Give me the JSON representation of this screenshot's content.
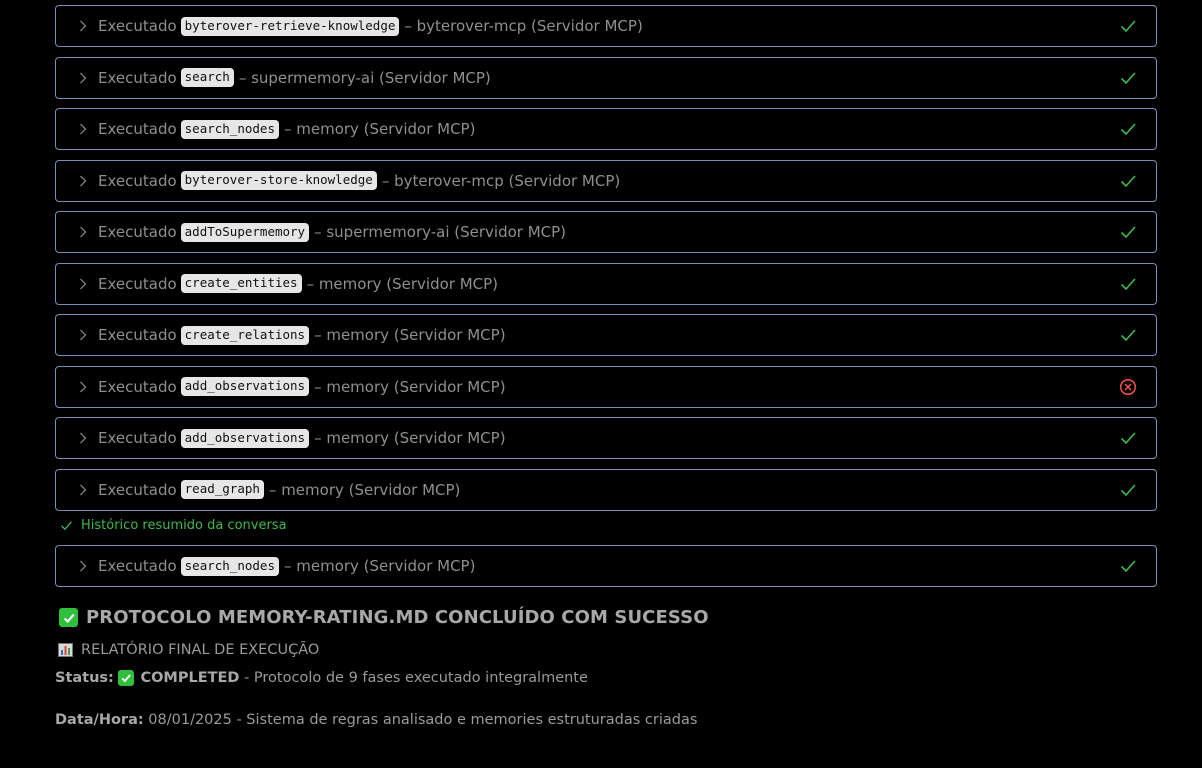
{
  "tool_calls": [
    {
      "verb": "Executado",
      "tool": "byterover-retrieve-knowledge",
      "server": "– byterover-mcp (Servidor MCP)",
      "status": "success"
    },
    {
      "verb": "Executado",
      "tool": "search",
      "server": "– supermemory-ai (Servidor MCP)",
      "status": "success"
    },
    {
      "verb": "Executado",
      "tool": "search_nodes",
      "server": "– memory (Servidor MCP)",
      "status": "success"
    },
    {
      "verb": "Executado",
      "tool": "byterover-store-knowledge",
      "server": "– byterover-mcp (Servidor MCP)",
      "status": "success"
    },
    {
      "verb": "Executado",
      "tool": "addToSupermemory",
      "server": "– supermemory-ai (Servidor MCP)",
      "status": "success"
    },
    {
      "verb": "Executado",
      "tool": "create_entities",
      "server": "– memory (Servidor MCP)",
      "status": "success"
    },
    {
      "verb": "Executado",
      "tool": "create_relations",
      "server": "– memory (Servidor MCP)",
      "status": "success"
    },
    {
      "verb": "Executado",
      "tool": "add_observations",
      "server": "– memory (Servidor MCP)",
      "status": "error"
    },
    {
      "verb": "Executado",
      "tool": "add_observations",
      "server": "– memory (Servidor MCP)",
      "status": "success"
    },
    {
      "verb": "Executado",
      "tool": "read_graph",
      "server": "– memory (Servidor MCP)",
      "status": "success"
    }
  ],
  "summary_note": "Histórico resumido da conversa",
  "tool_call_after": {
    "verb": "Executado",
    "tool": "search_nodes",
    "server": "– memory (Servidor MCP)",
    "status": "success"
  },
  "report": {
    "title": "PROTOCOLO MEMORY-RATING.MD CONCLUÍDO COM SUCESSO",
    "subtitle": "RELATÓRIO FINAL DE EXECUÇÃO",
    "status_label": "Status:",
    "status_value": "COMPLETED",
    "status_desc": " - Protocolo de 9 fases executado integralmente",
    "date_label": "Data/Hora:",
    "date_value": " 08/01/2025 - Sistema de regras analisado e memories estruturadas criadas"
  },
  "colors": {
    "success": "#3fb950",
    "error": "#f85149",
    "border": "#7290ba",
    "code_bg": "#e6e6e6"
  },
  "icons": {
    "chevron": "chevron-right-icon",
    "success": "check-icon",
    "error": "error-circle-icon",
    "report_title": "check-mark-button-emoji",
    "report_subtitle": "bar-chart-emoji"
  }
}
